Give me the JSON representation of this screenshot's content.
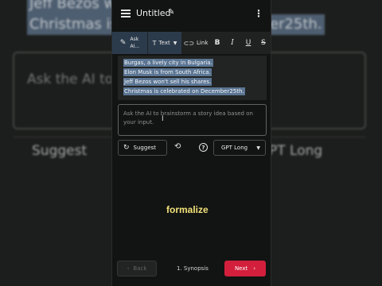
{
  "background": {
    "selected_lines": [
      "Jeff Bezos w",
      "Christmas is",
      "er25th."
    ],
    "prompt": "Ask the AI to                          n based on your input.",
    "suggest": "Suggest",
    "gpt": "PT Long"
  },
  "header": {
    "title": "Untitled",
    "edit_icon": "pencil-icon",
    "menu_icon": "hamburger-icon",
    "more_icon": "kebab-icon"
  },
  "toolbar": {
    "ask_ai_line1": "Ask",
    "ask_ai_line2": "AI...",
    "text_label": "Text",
    "link_label": "Link",
    "bold": "B",
    "italic": "I",
    "underline": "U",
    "strike": "S"
  },
  "editor": {
    "lines": [
      "Burgas, a lively city in Bulgaria.",
      "Elon Musk is from South Africa.",
      "Jeff Bezos won't sell his shares.",
      "Christmas is celebrated on December25th."
    ],
    "selection_color": "#5b7593"
  },
  "prompt": {
    "placeholder": "Ask the AI to brainstorm a story idea based on your input."
  },
  "controls": {
    "suggest_label": "Suggest",
    "model_selected": "GPT Long"
  },
  "overlay": {
    "word": "formalize",
    "color": "#f2e27a"
  },
  "footer": {
    "back_label": "Back",
    "step_label": "1. Synopsis",
    "next_label": "Next",
    "next_color": "#d21f3c"
  }
}
